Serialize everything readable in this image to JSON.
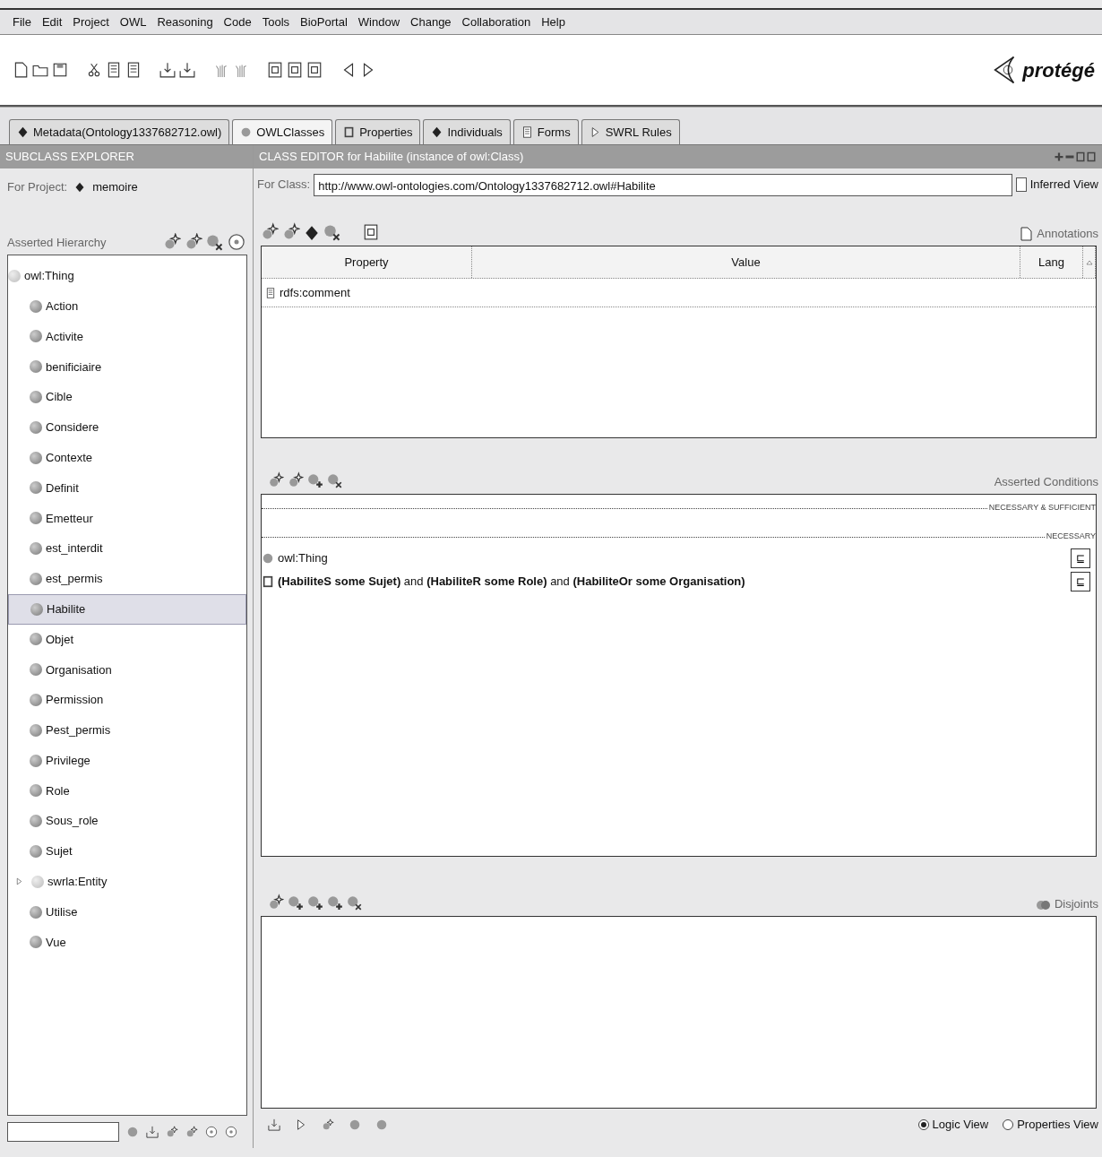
{
  "menu": [
    "File",
    "Edit",
    "Project",
    "OWL",
    "Reasoning",
    "Code",
    "Tools",
    "BioPortal",
    "Window",
    "Change",
    "Collaboration",
    "Help"
  ],
  "logo": {
    "text": "protégé"
  },
  "tabs": [
    {
      "label": "Metadata(Ontology1337682712.owl)",
      "kind": "diamond",
      "selected": false
    },
    {
      "label": "OWLClasses",
      "kind": "circle",
      "selected": true
    },
    {
      "label": "Properties",
      "kind": "square",
      "selected": false
    },
    {
      "label": "Individuals",
      "kind": "diamond",
      "selected": false
    },
    {
      "label": "Forms",
      "kind": "lines",
      "selected": false
    },
    {
      "label": "SWRL Rules",
      "kind": "arrow",
      "selected": false
    }
  ],
  "subclass_explorer": {
    "title": "SUBCLASS EXPLORER",
    "project_label": "For Project:",
    "project": "memoire",
    "hierarchy_label": "Asserted Hierarchy",
    "tree": [
      {
        "label": "owl:Thing",
        "kind": "root",
        "selected": false,
        "children": [
          {
            "label": "Action",
            "kind": "class",
            "selected": false
          },
          {
            "label": "Activite",
            "kind": "class",
            "selected": false
          },
          {
            "label": "benificiaire",
            "kind": "class",
            "selected": false
          },
          {
            "label": "Cible",
            "kind": "class",
            "selected": false
          },
          {
            "label": "Considere",
            "kind": "class",
            "selected": false
          },
          {
            "label": "Contexte",
            "kind": "class",
            "selected": false
          },
          {
            "label": "Definit",
            "kind": "class",
            "selected": false
          },
          {
            "label": "Emetteur",
            "kind": "class",
            "selected": false
          },
          {
            "label": "est_interdit",
            "kind": "class",
            "selected": false
          },
          {
            "label": "est_permis",
            "kind": "class",
            "selected": false
          },
          {
            "label": "Habilite",
            "kind": "class",
            "selected": true
          },
          {
            "label": "Objet",
            "kind": "class",
            "selected": false
          },
          {
            "label": "Organisation",
            "kind": "class",
            "selected": false
          },
          {
            "label": "Permission",
            "kind": "class",
            "selected": false
          },
          {
            "label": "Pest_permis",
            "kind": "class",
            "selected": false
          },
          {
            "label": "Privilege",
            "kind": "class",
            "selected": false
          },
          {
            "label": "Role",
            "kind": "class",
            "selected": false
          },
          {
            "label": "Sous_role",
            "kind": "class",
            "selected": false
          },
          {
            "label": "Sujet",
            "kind": "class",
            "selected": false
          },
          {
            "label": "swrla:Entity",
            "kind": "collapsed",
            "selected": false
          },
          {
            "label": "Utilise",
            "kind": "class",
            "selected": false
          },
          {
            "label": "Vue",
            "kind": "class",
            "selected": false
          }
        ]
      }
    ]
  },
  "class_editor": {
    "title": "CLASS EDITOR for Habilite   (instance of owl:Class)",
    "for_class_label": "For Class:",
    "for_class_value": "http://www.owl-ontologies.com/Ontology1337682712.owl#Habilite",
    "inferred_view": {
      "label": "Inferred View",
      "checked": false
    },
    "annotations_label": "Annotations",
    "table": {
      "columns": [
        "Property",
        "Value",
        "Lang"
      ],
      "rows": [
        {
          "property": "rdfs:comment"
        }
      ]
    },
    "conditions_label": "Asserted Conditions",
    "sections": [
      {
        "label": "NECESSARY & SUFFICIENT"
      },
      {
        "label": "NECESSARY",
        "rows": [
          {
            "kind": "named",
            "text": "owl:Thing",
            "symbol": "⊑"
          },
          {
            "kind": "anonymous",
            "text": "**(HabiliteS some Sujet)** and **(HabiliteR some Role)** and **(HabiliteOr some Organisation)**",
            "symbol": "⊑"
          }
        ]
      }
    ],
    "disjoints_label": "Disjoints",
    "views": [
      {
        "label": "Logic View",
        "selected": true
      },
      {
        "label": "Properties View",
        "selected": false
      }
    ]
  }
}
